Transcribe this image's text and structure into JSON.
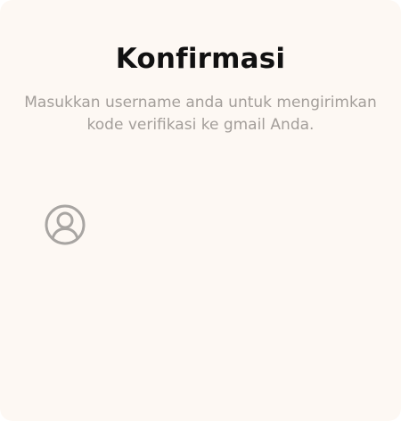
{
  "dialog": {
    "title": "Konfirmasi",
    "subtitle": "Masukkan username anda untuk mengirimkan kode verifikasi ke gmail Anda."
  },
  "username_field": {
    "icon": "user-circle-icon",
    "value": "",
    "placeholder": ""
  },
  "colors": {
    "card_background": "#fdf8f3",
    "title": "#111111",
    "subtitle": "#a39e9a",
    "icon": "#a8a5a2"
  }
}
